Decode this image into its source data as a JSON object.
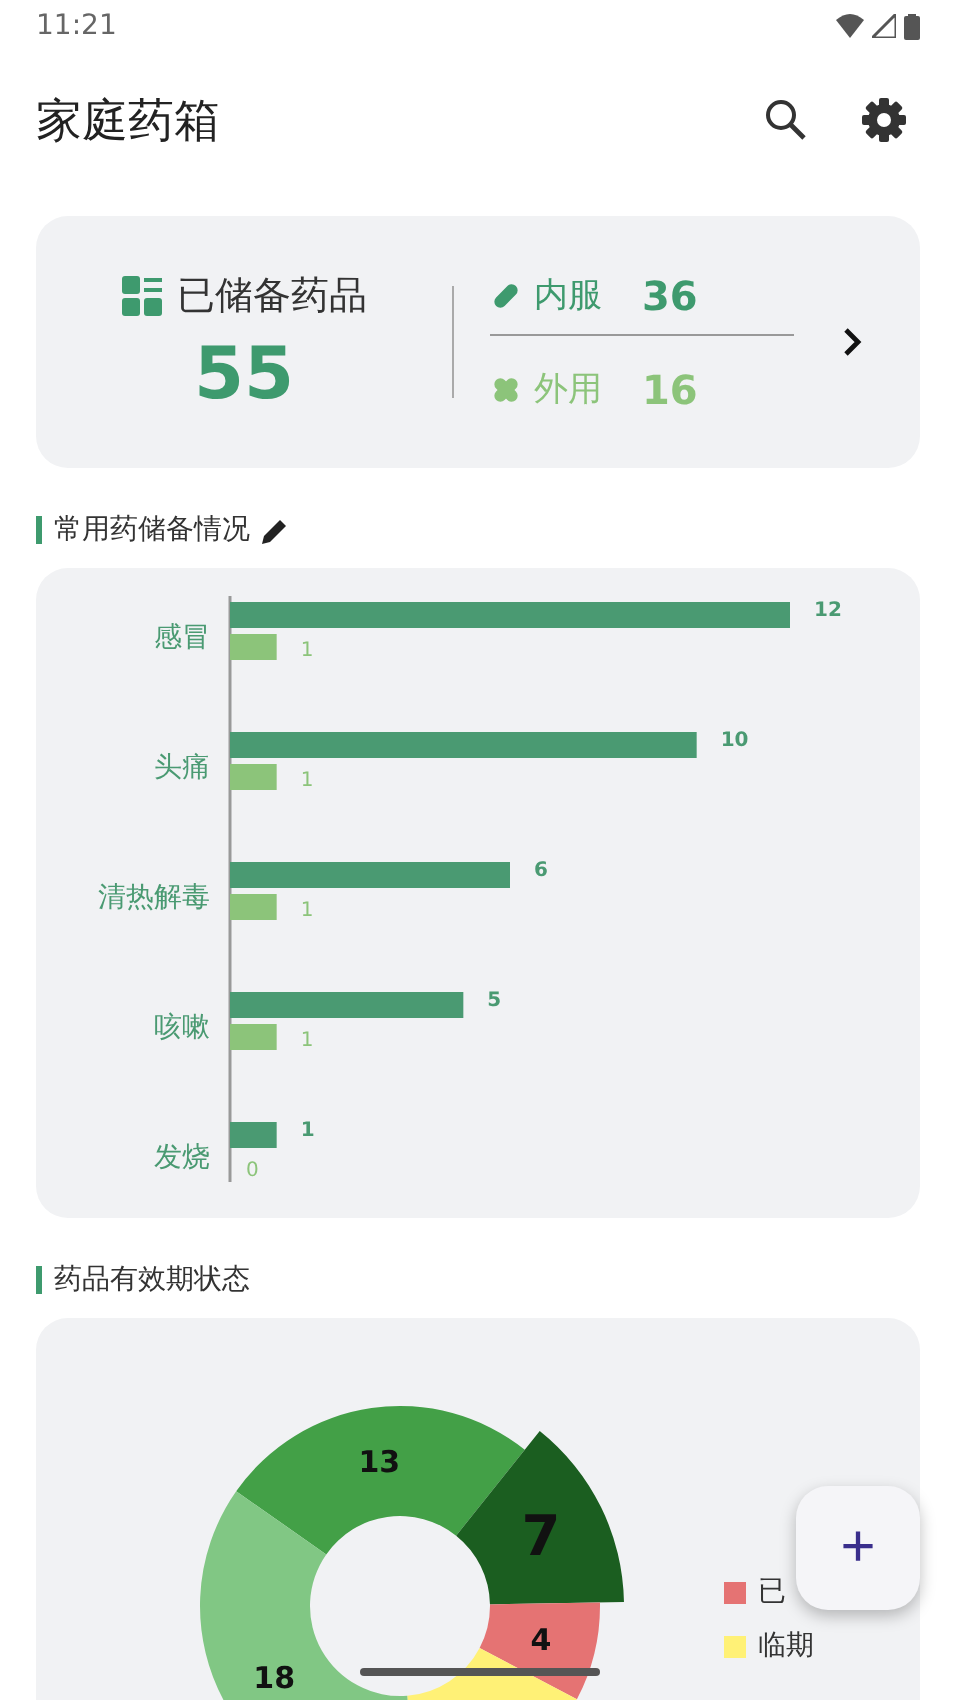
{
  "status_bar": {
    "time": "11:21"
  },
  "app_bar": {
    "title": "家庭药箱"
  },
  "summary": {
    "label": "已储备药品",
    "total": "55",
    "types": [
      {
        "kind": "oral",
        "label": "内服",
        "count": "36"
      },
      {
        "kind": "external",
        "label": "外用",
        "count": "16"
      }
    ]
  },
  "stock_section": {
    "title": "常用药储备情况",
    "chart_data": {
      "type": "bar",
      "orientation": "horizontal",
      "categories": [
        "感冒",
        "头痛",
        "清热解毒",
        "咳嗽",
        "发烧"
      ],
      "xlim": [
        0,
        12
      ],
      "data_labels": true,
      "series": [
        {
          "color": "#4a9a72",
          "values": [
            12,
            10,
            6,
            5,
            1
          ]
        },
        {
          "color": "#8cc47a",
          "values": [
            1,
            1,
            1,
            1,
            0
          ]
        }
      ]
    }
  },
  "expiry_section": {
    "title": "药品有效期状态",
    "chart_data": {
      "type": "donut",
      "value_labels": [
        "13",
        "7",
        "4",
        null,
        "18"
      ],
      "series": [
        {
          "values": [
            26,
            14,
            8,
            16,
            36
          ],
          "colors": [
            "#43a047",
            "#1b5e20",
            "#e57373",
            "#fff176",
            "#81c784"
          ]
        }
      ]
    },
    "legend": [
      {
        "label": "已",
        "color": "#e57373"
      },
      {
        "label": "临期",
        "color": "#fff176"
      }
    ]
  },
  "fab": {
    "symbol": "+"
  }
}
